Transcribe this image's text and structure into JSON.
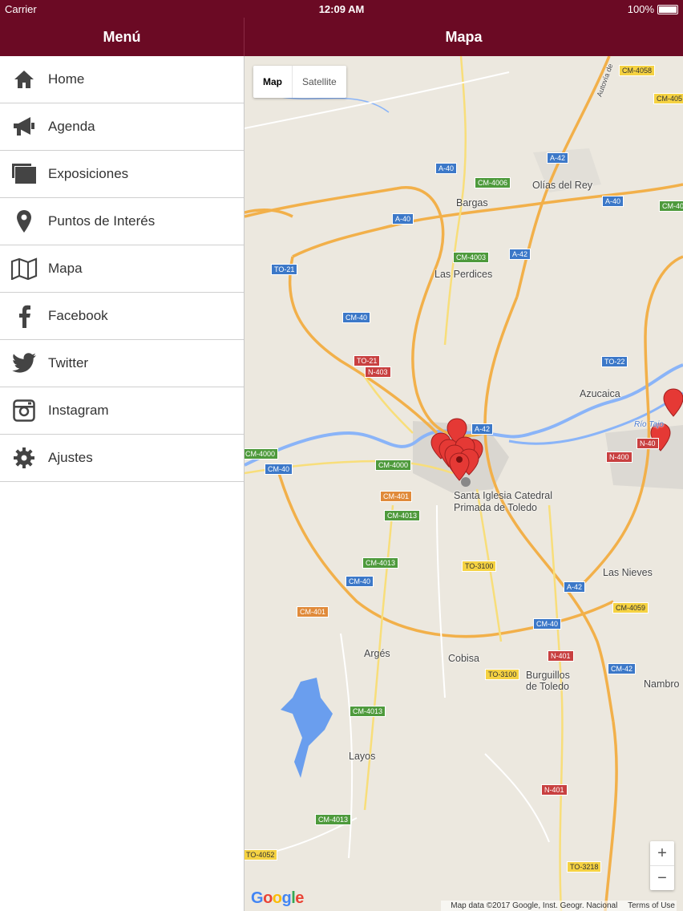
{
  "status": {
    "carrier": "Carrier",
    "time": "12:09 AM",
    "battery": "100%"
  },
  "header": {
    "menu_title": "Menú",
    "map_title": "Mapa"
  },
  "menu": {
    "items": [
      {
        "label": "Home",
        "icon": "home-icon"
      },
      {
        "label": "Agenda",
        "icon": "megaphone-icon"
      },
      {
        "label": "Exposiciones",
        "icon": "gallery-icon"
      },
      {
        "label": "Puntos de Interés",
        "icon": "location-pin-icon"
      },
      {
        "label": "Mapa",
        "icon": "map-icon"
      },
      {
        "label": "Facebook",
        "icon": "facebook-icon"
      },
      {
        "label": "Twitter",
        "icon": "twitter-icon"
      },
      {
        "label": "Instagram",
        "icon": "instagram-icon"
      },
      {
        "label": "Ajustes",
        "icon": "gear-icon"
      }
    ]
  },
  "map": {
    "type_map": "Map",
    "type_satellite": "Satellite",
    "zoom_in": "+",
    "zoom_out": "−",
    "attribution": "Map data ©2017 Google, Inst. Geogr. Nacional",
    "terms": "Terms of Use",
    "logo": "Google",
    "places": {
      "olias": "Olías del Rey",
      "bargas": "Bargas",
      "perdices": "Las Perdices",
      "azucaica": "Azucaica",
      "catedral1": "Santa Iglesia Catedral",
      "catedral2": "Primada de Toledo",
      "nieves": "Las Nieves",
      "arges": "Argés",
      "cobisa": "Cobisa",
      "burg1": "Burguillos",
      "burg2": "de Toledo",
      "nambro": "Nambro",
      "layos": "Layos",
      "rio": "Río Tajo",
      "autovia": "Autovía de"
    },
    "roads": {
      "r1": "CM-4058",
      "r2": "CM-405",
      "r3": "A-40",
      "r4": "CM-4006",
      "r5": "A-42",
      "r6": "A-40",
      "r7": "CM-40",
      "r8": "A-40",
      "r9": "TO-21",
      "r10": "CM-4003",
      "r11": "A-42",
      "r12": "CM-40",
      "r13": "TO-21",
      "r14": "N-403",
      "r15": "TO-22",
      "r16": "A-42",
      "r17": "N-40",
      "r18": "N-400",
      "r19": "CM-4000",
      "r20": "CM-40",
      "r21": "CM-4000",
      "r22": "CM-401",
      "r23": "CM-4013",
      "r24": "CM-4013",
      "r25": "TO-3100",
      "r26": "CM-40",
      "r27": "A-42",
      "r28": "CM-4059",
      "r29": "CM-401",
      "r30": "CM-40",
      "r31": "N-401",
      "r32": "TO-3100",
      "r33": "CM-42",
      "r34": "CM-4013",
      "r35": "N-401",
      "r36": "CM-4013",
      "r37": "TO-4052",
      "r38": "TO-3218"
    }
  }
}
